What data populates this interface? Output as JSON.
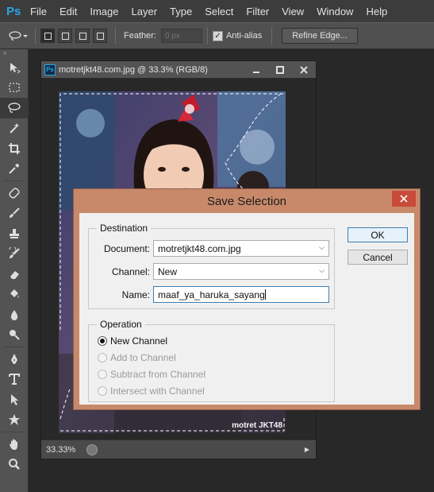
{
  "app": {
    "logo": "Ps",
    "menu": [
      "File",
      "Edit",
      "Image",
      "Layer",
      "Type",
      "Select",
      "Filter",
      "View",
      "Window",
      "Help"
    ]
  },
  "options_bar": {
    "tool_icon": "lasso-icon",
    "feather_label": "Feather:",
    "feather_placeholder": "0 px",
    "antialias_label": "Anti-alias",
    "antialias_checked": true,
    "refine_edge_label": "Refine Edge..."
  },
  "toolbar": {
    "tools": [
      "move",
      "marquee",
      "lasso",
      "magic-wand",
      "crop",
      "eyedropper",
      "healing",
      "brush",
      "stamp",
      "history-brush",
      "eraser",
      "paint-bucket",
      "blur",
      "dodge",
      "pen",
      "type",
      "path-selection",
      "shape",
      "hand",
      "zoom"
    ],
    "selected": "lasso"
  },
  "document": {
    "title": "motretjkt48.com.jpg @ 33.3% (RGB/8)",
    "watermark": "motret JKT48",
    "zoom": "33.33%"
  },
  "dialog": {
    "title": "Save Selection",
    "destination_label": "Destination",
    "document_label": "Document:",
    "document_value": "motretjkt48.com.jpg",
    "channel_label": "Channel:",
    "channel_value": "New",
    "name_label": "Name:",
    "name_value": "maaf_ya_haruka_sayang",
    "operation_label": "Operation",
    "operations": [
      {
        "label": "New Channel",
        "selected": true,
        "enabled": true
      },
      {
        "label": "Add to Channel",
        "selected": false,
        "enabled": false
      },
      {
        "label": "Subtract from Channel",
        "selected": false,
        "enabled": false
      },
      {
        "label": "Intersect with Channel",
        "selected": false,
        "enabled": false
      }
    ],
    "ok_label": "OK",
    "cancel_label": "Cancel"
  }
}
